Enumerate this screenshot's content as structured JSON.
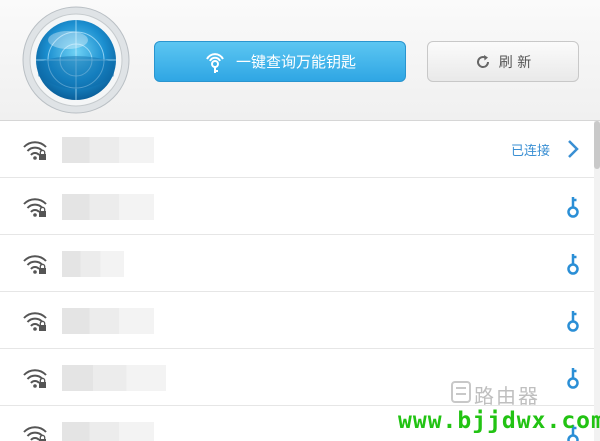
{
  "toolbar": {
    "query_label": "一键查询万能钥匙",
    "refresh_label": "刷 新"
  },
  "networks": [
    {
      "status": "已连接",
      "action": "chevron-right-icon"
    },
    {
      "status": "",
      "action": "key-icon"
    },
    {
      "status": "",
      "action": "key-icon"
    },
    {
      "status": "",
      "action": "key-icon"
    },
    {
      "status": "",
      "action": "key-icon"
    },
    {
      "status": "",
      "action": "key-icon"
    }
  ],
  "watermark": {
    "url": "www.bjjdwx.com",
    "cn": "路由器"
  },
  "colors": {
    "accent_blue": "#2fa6e4",
    "status_blue": "#3a8fd3",
    "watermark_green": "#22c313"
  }
}
